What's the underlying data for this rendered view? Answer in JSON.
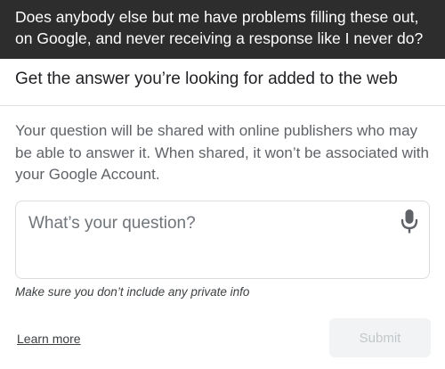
{
  "overlay": {
    "text": "Does anybody else but me have problems filling these out, on Google, and never receiving a response like I never do?"
  },
  "header": {
    "title": "Get the answer you’re looking for added to the web"
  },
  "description": "Your question will be shared with online publishers who may be able to answer it. When shared, it won’t be associated with your Google Account.",
  "question": {
    "placeholder": "What’s your question?",
    "value": "",
    "mic_icon": "microphone-icon"
  },
  "private_note": "Make sure you don’t include any private info",
  "footer": {
    "learn_more": "Learn more",
    "submit": "Submit",
    "submit_disabled": true
  },
  "colors": {
    "overlay_bg": "#2d2d2d",
    "text_primary": "#202124",
    "text_secondary": "#5f6368",
    "icon": "#5f6368",
    "submit_disabled_bg": "#f1f3f4",
    "submit_disabled_text": "#c4c7c9"
  }
}
